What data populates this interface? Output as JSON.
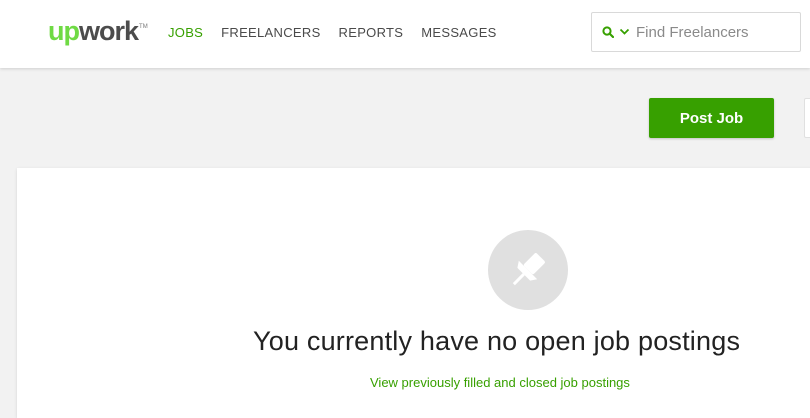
{
  "header": {
    "logo": {
      "up": "up",
      "work": "work",
      "tm": "TM"
    },
    "nav": [
      {
        "label": "JOBS",
        "active": true
      },
      {
        "label": "FREELANCERS",
        "active": false
      },
      {
        "label": "REPORTS",
        "active": false
      },
      {
        "label": "MESSAGES",
        "active": false
      }
    ],
    "search": {
      "placeholder": "Find Freelancers",
      "value": "",
      "icons": [
        "search-icon",
        "chevron-down-icon"
      ]
    }
  },
  "actions": {
    "post_job_label": "Post Job"
  },
  "empty_state": {
    "icon": "pushpin-icon",
    "title": "You currently have no open job postings",
    "link_label": "View previously filled and closed job postings"
  },
  "colors": {
    "brand_green": "#37a000",
    "logo_green": "#6fda44",
    "background": "#f2f2f2"
  }
}
